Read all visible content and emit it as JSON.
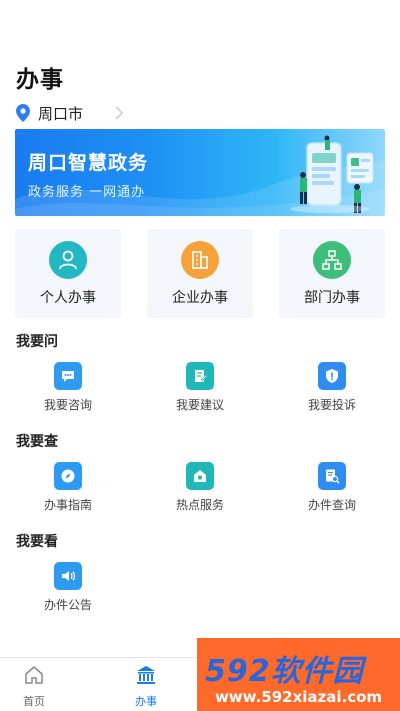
{
  "header": {
    "title": "办事"
  },
  "location": {
    "city": "周口市"
  },
  "banner": {
    "title": "周口智慧政务",
    "subtitle": "政务服务 一网通办"
  },
  "categories": [
    {
      "label": "个人办事",
      "icon": "person-icon",
      "color": "#22b7c2"
    },
    {
      "label": "企业办事",
      "icon": "building-icon",
      "color": "#f6a23a"
    },
    {
      "label": "部门办事",
      "icon": "org-chart-icon",
      "color": "#3fbd7b"
    }
  ],
  "sections": {
    "ask": {
      "title": "我要问",
      "items": [
        {
          "label": "我要咨询",
          "icon": "chat-icon",
          "color": "#2f9bf0"
        },
        {
          "label": "我要建议",
          "icon": "edit-note-icon",
          "color": "#20b8b6"
        },
        {
          "label": "我要投诉",
          "icon": "shield-alert-icon",
          "color": "#2f8cf0"
        }
      ]
    },
    "check": {
      "title": "我要查",
      "items": [
        {
          "label": "办事指南",
          "icon": "compass-icon",
          "color": "#2f9bf0"
        },
        {
          "label": "热点服务",
          "icon": "home-heart-icon",
          "color": "#20b8b6"
        },
        {
          "label": "办件查询",
          "icon": "document-search-icon",
          "color": "#2f8cf0"
        }
      ]
    },
    "view": {
      "title": "我要看",
      "items": [
        {
          "label": "办件公告",
          "icon": "speaker-icon",
          "color": "#2f9bf0"
        }
      ]
    }
  },
  "tabbar": {
    "items": [
      {
        "label": "首页",
        "icon": "house-icon"
      },
      {
        "label": "办事",
        "icon": "government-building-icon"
      }
    ],
    "active_color": "#1a7bf0"
  },
  "watermark": {
    "brand": "592软件园",
    "url": "www.592xiazai.com"
  }
}
